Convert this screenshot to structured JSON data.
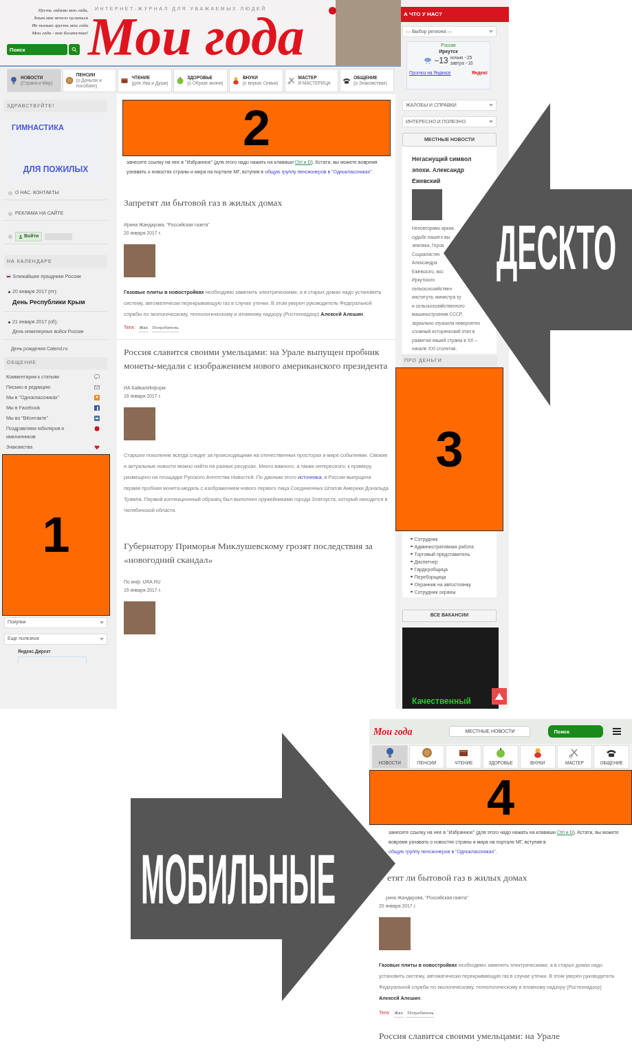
{
  "desktop": {
    "header": {
      "tagline_lines": [
        "Пусть годами мои года,",
        "Злым мне нечего пугаться",
        "Не только грусть мои года",
        "Мои года - мое богатство!"
      ],
      "subtitle": "ИНТЕРНЕТ-ЖУРНАЛ ДЛЯ УВАЖАЕМЫХ ЛЮДЕЙ",
      "logo": "Мои года",
      "search": {
        "placeholder": "Поиск"
      }
    },
    "nav_tabs": [
      {
        "kind": "globe",
        "label": "НОВОСТИ",
        "sublabel": "(Страна и Мир)",
        "selected": true
      },
      {
        "kind": "coin",
        "label": "ПЕНСИИ",
        "sublabel": "(о Деньгах и пособиях)",
        "selected": false
      },
      {
        "kind": "book",
        "label": "ЧТЕНИЕ",
        "sublabel": "(для Ума и Души)",
        "selected": false
      },
      {
        "kind": "apple",
        "label": "ЗДОРОВЬЕ",
        "sublabel": "(о Образе жизни)",
        "selected": false
      },
      {
        "kind": "doll",
        "label": "ВНУКИ",
        "sublabel": "(о внуках Семьи)",
        "selected": false
      },
      {
        "kind": "tools",
        "label": "МАСТЕР",
        "sublabel": "И МАСТЕРИЦА",
        "selected": false
      },
      {
        "kind": "phone",
        "label": "ОБЩЕНИЕ",
        "sublabel": "(о Знакомствах)",
        "selected": false
      }
    ],
    "left_sidebar": {
      "greeting": "ЗДРАВСТВУЙТЕ!",
      "banner": {
        "line_1": "ГИМНАСТИКА",
        "line_2": "ДЛЯ ПОЖИЛЫХ"
      },
      "links": [
        "О НАС. КОНТАКТЫ",
        "РЕКЛАМА НА САЙТЕ"
      ],
      "login": "Войти",
      "calendar": {
        "title": "НА КАЛЕНДАРЕ",
        "holidays_link": "Ближайшие праздники России",
        "events": [
          {
            "date": "20 января 2017 (пт):",
            "name": "День Республики Крым",
            "highlight": true
          },
          {
            "date": "21 января 2017 (сб):",
            "name": "День инженерных войск России",
            "highlight": false
          }
        ],
        "footer": "День рождения Calend.ru"
      },
      "community": {
        "title": "ОБЩЕНИЕ",
        "items": [
          {
            "kind": "comment",
            "label": "Комментарии к статьям"
          },
          {
            "kind": "mail",
            "label": "Письмо в редакцию"
          },
          {
            "kind": "ok",
            "label": "Мы в \"Одноклассниках\""
          },
          {
            "kind": "facebook",
            "label": "Мы в Facebook"
          },
          {
            "kind": "vk",
            "label": "Мы во \"ВКонтакте\""
          },
          {
            "kind": "flower",
            "label": "Поздравляем юбиляров и именинников"
          },
          {
            "kind": "heart",
            "label": "Знакомства"
          }
        ]
      },
      "marker": "1",
      "selects": [
        "Покупки",
        "Еще полезное"
      ],
      "ad_label": "Яндекс.Директ"
    },
    "main": {
      "marker": "2",
      "intro": [
        {
          "kind": "text",
          "text": "занесите ссылку на нее в \"Избранное\" (для этого надо нажать на клавиши "
        },
        {
          "kind": "shortcut",
          "text": "Ctrl и D"
        },
        {
          "kind": "text",
          "text": "). Кстати, вы можете вовремя узнавать о новостях страны и мира на портале МГ, вступив в "
        },
        {
          "kind": "link",
          "text": "общую группу пенсионеров в \"Одноклассниках\""
        },
        {
          "kind": "text",
          "text": "."
        }
      ],
      "articles": [
        {
          "title": "Запретят ли бытовой газ в жилых домах",
          "source": "Ирина Жандарова, \"Российская газета\"",
          "date": "20 января 2017 г.",
          "body": [
            {
              "kind": "bold",
              "text": "Газовые плиты в новостройках"
            },
            {
              "kind": "text",
              "text": " необходимо заменить электрическими, а в старых домах надо установить систему, автоматически перекрывающую газ в случае утечки. В этом уверен руководитель Федеральной службы по экологическому, технологическому и атомному надзору (Ростехнадзор) "
            },
            {
              "kind": "bold",
              "text": "Алексей Алешин"
            },
            {
              "kind": "text",
              "text": "."
            }
          ],
          "tags_label": "Теги:",
          "tags": [
            "Жкх",
            "Потребитель"
          ]
        },
        {
          "title": "Россия славится своими умельцами: на Урале выпущен пробник монеты-медали с изображением нового американского президента",
          "source": "ИА БайкалИнформ",
          "date": "19 января 2017 г.",
          "body": [
            {
              "kind": "text",
              "text": "Старшее поколение всегда следит за происходящими на отечественных просторах и мире событиями. Свежие и актуальные новости можно найти на разных ресурсах. Много важного, а также интересного, к примеру, размещено на площадке Русского Агентства Новостей. По данным этого "
            },
            {
              "kind": "link",
              "text": "источника"
            },
            {
              "kind": "text",
              "text": ", в России выпущена первая пробная монета-медаль с изображением нового первого лица Соединенных Штатов Америки Дональда Трампа. Первый коллекционный образец был выполнен оружейниками города Златоуста, который находится в Челябинской области."
            }
          ]
        },
        {
          "title": "Губернатору Приморья Миклушевскому грозят последствия за «новогодний скандал»",
          "source": "По инф. URA.RU",
          "date": "19 января 2017 г."
        }
      ]
    },
    "right_sidebar": {
      "region_title": "А ЧТО У НАС?",
      "region_select": "--- Выбор региона ---",
      "weather": {
        "country": "Россия",
        "city": "Иркутск",
        "temperature": "−13",
        "night": "ночью −25",
        "tomorrow": "завтра −16",
        "link": "Прогноз на Яндексе",
        "brand": "Яндекс"
      },
      "selects": [
        "ЖАЛОБЫ И СПРАВКИ",
        "ИНТЕРЕСНО И ПОЛЕЗНО"
      ],
      "local_news_button": "МЕСТНЫЕ НОВОСТИ",
      "article": {
        "title": "Негаснущий символ эпохи. Александр Ежевский",
        "lines": [
          "Неповторимо яркая,",
          "судьбе нашего вы",
          "земляка, Героя",
          "Социалистич",
          "Александра",
          "Ежевского, вос",
          "Иркутского",
          "сельскохозяйствен",
          "института, министра тр",
          "и сельскохозяйственного",
          "машиностроения СССР,",
          "зеркально отразила невероятно",
          "сложный исторический этап в",
          "развитии нашей страны в XX –",
          "начале XXI столетия."
        ]
      },
      "money_title": "ПРО ДЕНЬГИ",
      "marker": "3",
      "vacancies": [
        "Сотрудник",
        "Административная работа",
        "Торговый представитель",
        "Диспетчер",
        "Гардеробщица",
        "Переборщица",
        "Охранник на автостоянку",
        "Сотрудник охраны"
      ],
      "vacancies_button": "ВСЕ ВАКАНСИИ",
      "ad_text": "Качественный"
    }
  },
  "mobile": {
    "logo": "Мои года",
    "local_news_button": "МЕСТНЫЕ НОВОСТИ",
    "search": {
      "placeholder": "Поиск"
    },
    "tabs": [
      {
        "kind": "globe",
        "label": "НОВОСТИ",
        "selected": true
      },
      {
        "kind": "coin",
        "label": "ПЕНСИИ",
        "selected": false
      },
      {
        "kind": "book",
        "label": "ЧТЕНИЕ",
        "selected": false
      },
      {
        "kind": "apple",
        "label": "ЗДОРОВЬЕ",
        "selected": false
      },
      {
        "kind": "doll",
        "label": "ВНУКИ",
        "selected": false
      },
      {
        "kind": "tools",
        "label": "МАСТЕР",
        "selected": false
      },
      {
        "kind": "phone",
        "label": "ОБЩЕНИЕ",
        "selected": false
      }
    ],
    "marker": "4",
    "intro": [
      {
        "kind": "text",
        "text": "занесите ссылку на нее в \"Избранное\" (для этого надо нажать на клавиши "
      },
      {
        "kind": "shortcut",
        "text": "Ctrl и D"
      },
      {
        "kind": "text",
        "text": "). Кстати, вы можете вовремя узнавать о новостях страны и мира на портале МГ, вступив в "
      },
      {
        "kind": "link",
        "text": "общую группу пенсионеров в \"Одноклассниках\""
      },
      {
        "kind": "text",
        "text": "."
      }
    ],
    "article": {
      "title": "етят ли бытовой газ в жилых домах",
      "source": "рина Жандарова, \"Российская газета\"",
      "date": "20 января 2017 г.",
      "body": [
        {
          "kind": "bold",
          "text": "Газовые плиты в новостройках"
        },
        {
          "kind": "text",
          "text": " необходимо заменить электрическими, а в старых домах надо установить систему, автоматически перекрывающую газ в случае утечки. В этом уверен руководитель Федеральной службы по экологическому, технологическому и атомному надзору (Ростехнадзор) "
        },
        {
          "kind": "bold",
          "text": "Алексей Алешин"
        },
        {
          "kind": "text",
          "text": "."
        }
      ],
      "tags_label": "Теги:",
      "tags": [
        "Жкх",
        "Потребитель"
      ]
    },
    "next_title": "Россия славится своими умельцами: на Урале"
  },
  "arrows": [
    {
      "kind": "left",
      "label": "ДЕСКТО"
    },
    {
      "kind": "right",
      "label": "МОБИЛЬНЫЕ"
    }
  ]
}
